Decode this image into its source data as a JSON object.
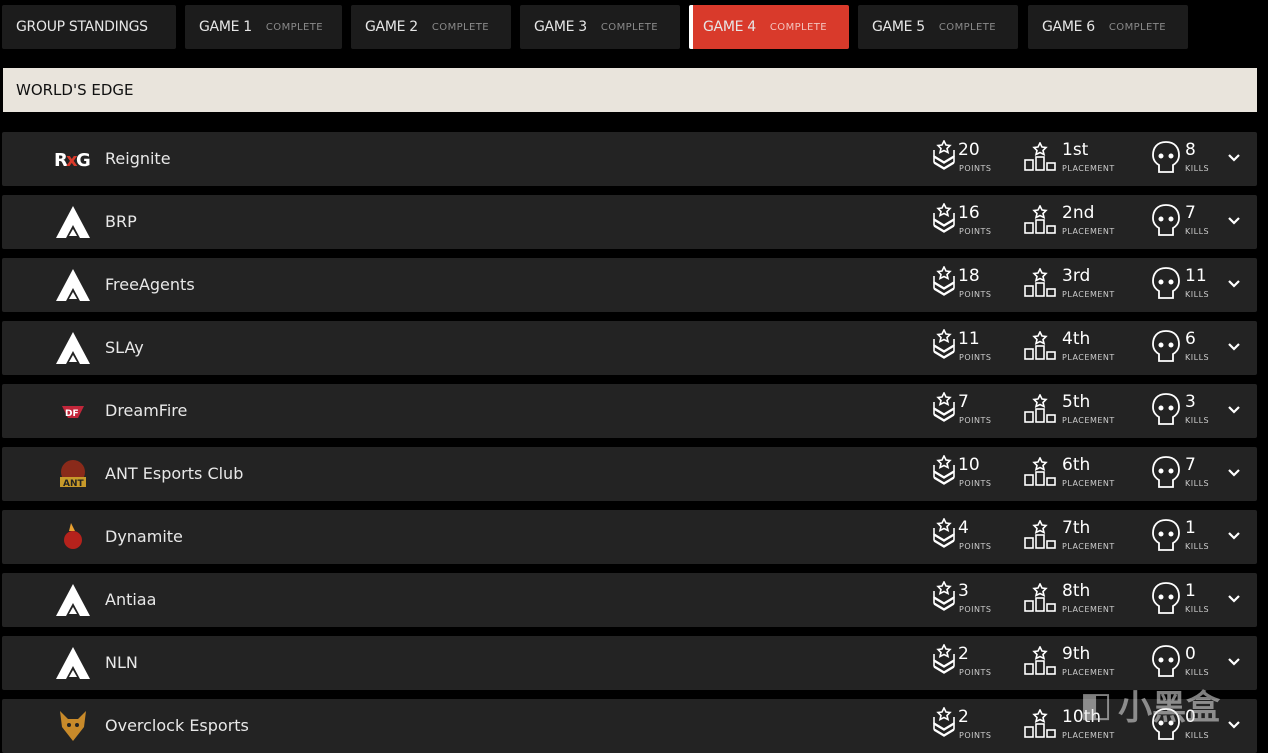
{
  "tabs": [
    {
      "title": "GROUP STANDINGS",
      "status": ""
    },
    {
      "title": "GAME 1",
      "status": "COMPLETE"
    },
    {
      "title": "GAME 2",
      "status": "COMPLETE"
    },
    {
      "title": "GAME 3",
      "status": "COMPLETE"
    },
    {
      "title": "GAME 4",
      "status": "COMPLETE",
      "active": true
    },
    {
      "title": "GAME 5",
      "status": "COMPLETE"
    },
    {
      "title": "GAME 6",
      "status": "COMPLETE"
    }
  ],
  "map_name": "WORLD'S EDGE",
  "labels": {
    "points": "POINTS",
    "placement": "PLACEMENT",
    "kills": "KILLS"
  },
  "teams": [
    {
      "name": "Reignite",
      "logo": "rg",
      "points": "20",
      "placement": "1st",
      "kills": "8"
    },
    {
      "name": "BRP",
      "logo": "apex",
      "points": "16",
      "placement": "2nd",
      "kills": "7"
    },
    {
      "name": "FreeAgents",
      "logo": "apex",
      "points": "18",
      "placement": "3rd",
      "kills": "11"
    },
    {
      "name": "SLAy",
      "logo": "apex",
      "points": "11",
      "placement": "4th",
      "kills": "6"
    },
    {
      "name": "DreamFire",
      "logo": "df",
      "points": "7",
      "placement": "5th",
      "kills": "3"
    },
    {
      "name": "ANT Esports Club",
      "logo": "ant",
      "points": "10",
      "placement": "6th",
      "kills": "7"
    },
    {
      "name": "Dynamite",
      "logo": "dyn",
      "points": "4",
      "placement": "7th",
      "kills": "1"
    },
    {
      "name": "Antiaa",
      "logo": "apex",
      "points": "3",
      "placement": "8th",
      "kills": "1"
    },
    {
      "name": "NLN",
      "logo": "apex",
      "points": "2",
      "placement": "9th",
      "kills": "0"
    },
    {
      "name": "Overclock Esports",
      "logo": "oc",
      "points": "2",
      "placement": "10th",
      "kills": "0"
    }
  ],
  "colors": {
    "active_tab": "#d93a2b",
    "map_bar": "#e9e4dc",
    "row_bg": "#232323"
  },
  "watermark": "小黑盒"
}
